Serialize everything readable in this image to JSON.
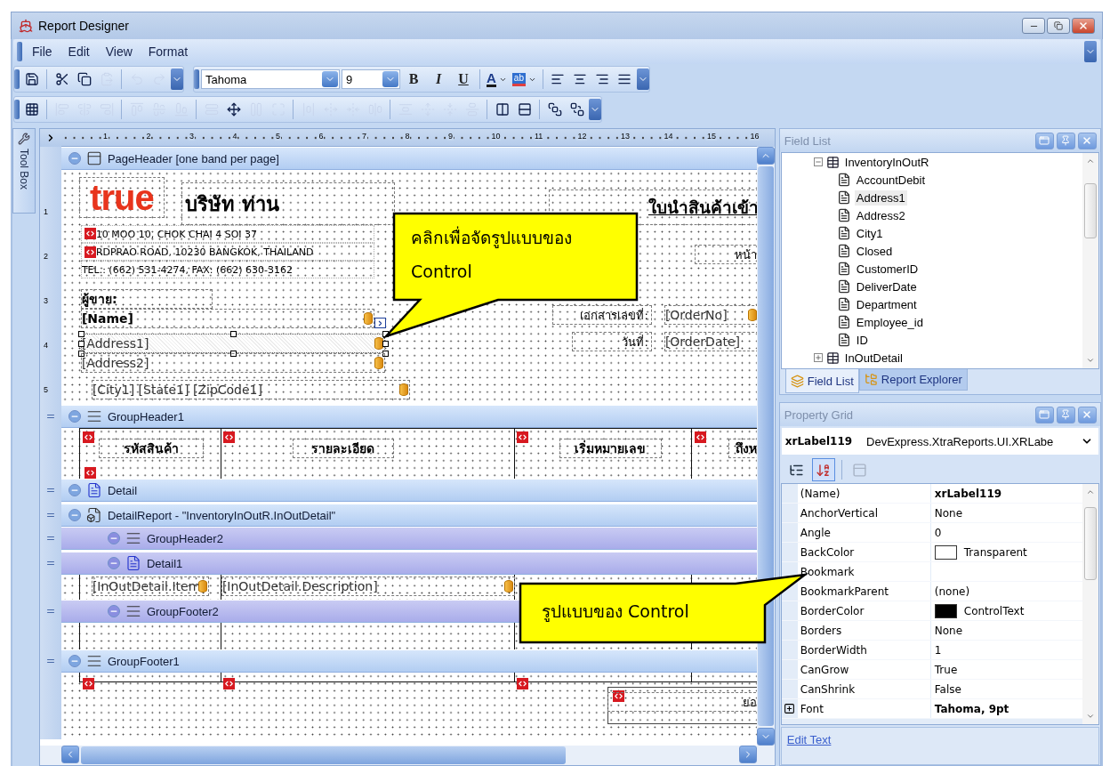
{
  "window": {
    "title": "Report Designer"
  },
  "menu": [
    {
      "label": "File"
    },
    {
      "label": "Edit"
    },
    {
      "label": "View"
    },
    {
      "label": "Format"
    }
  ],
  "toolbars": [
    {
      "groups": [
        [
          {
            "kind": "save",
            "disabled": false
          },
          {
            "kind": "sep"
          },
          {
            "kind": "cut",
            "disabled": false
          },
          {
            "kind": "copy",
            "disabled": false
          },
          {
            "kind": "paste",
            "disabled": true
          },
          {
            "kind": "sep"
          },
          {
            "kind": "undo",
            "disabled": true
          },
          {
            "kind": "redo",
            "disabled": true
          },
          {
            "kind": "overflow"
          }
        ],
        [
          {
            "kind": "combo",
            "value": "Tahoma"
          },
          {
            "kind": "size",
            "value": "9"
          },
          {
            "kind": "bold",
            "label": "B"
          },
          {
            "kind": "italic",
            "label": "I"
          },
          {
            "kind": "underline",
            "label": "U"
          },
          {
            "kind": "sep"
          },
          {
            "kind": "font_color",
            "label": "A"
          },
          {
            "kind": "highlight",
            "label": "ab"
          },
          {
            "kind": "sep"
          },
          {
            "kind": "align_left",
            "disabled": false
          },
          {
            "kind": "align_center",
            "disabled": false
          },
          {
            "kind": "align_right",
            "disabled": false
          },
          {
            "kind": "justify",
            "disabled": false
          },
          {
            "kind": "overflow"
          }
        ]
      ]
    },
    {
      "groups": [
        [
          {
            "kind": "snap_grid",
            "disabled": false
          },
          {
            "kind": "sep"
          },
          {
            "kind": "align_lefts",
            "disabled": true
          },
          {
            "kind": "align_centers",
            "disabled": true
          },
          {
            "kind": "align_rights",
            "disabled": true
          },
          {
            "kind": "sep"
          },
          {
            "kind": "align_tops",
            "disabled": true
          },
          {
            "kind": "align_middles",
            "disabled": true
          },
          {
            "kind": "align_bottoms",
            "disabled": true
          },
          {
            "kind": "sep"
          },
          {
            "kind": "same_width",
            "disabled": true
          },
          {
            "kind": "size_to_grid",
            "disabled": false
          },
          {
            "kind": "same_height",
            "disabled": true
          },
          {
            "kind": "same_size",
            "disabled": true
          },
          {
            "kind": "sep"
          },
          {
            "kind": "h_equal",
            "disabled": true
          },
          {
            "kind": "h_inc",
            "disabled": true
          },
          {
            "kind": "h_dec",
            "disabled": true
          },
          {
            "kind": "h_remove",
            "disabled": true
          },
          {
            "kind": "sep"
          },
          {
            "kind": "v_equal",
            "disabled": true
          },
          {
            "kind": "v_inc",
            "disabled": true
          },
          {
            "kind": "v_dec",
            "disabled": true
          },
          {
            "kind": "v_remove",
            "disabled": true
          },
          {
            "kind": "sep"
          },
          {
            "kind": "center_h",
            "disabled": false
          },
          {
            "kind": "center_v",
            "disabled": false
          },
          {
            "kind": "sep"
          },
          {
            "kind": "bring_front",
            "disabled": false
          },
          {
            "kind": "send_back",
            "disabled": false
          },
          {
            "kind": "overflow"
          }
        ]
      ]
    }
  ],
  "toolbox": {
    "label": "Tool Box"
  },
  "designer": {
    "ruler": [
      "1",
      "2",
      "3",
      "4",
      "5",
      "6",
      "7",
      "8",
      "9",
      "10",
      "11",
      "12",
      "13",
      "14",
      "15",
      "16"
    ],
    "bands": [
      {
        "kind": "page_header",
        "title": "PageHeader [one band per page]",
        "ruler": [
          "1",
          "2",
          "3",
          "4",
          "5"
        ],
        "controls": [
          {
            "kind": "logo",
            "text": "true",
            "selected": false,
            "bound": false
          },
          {
            "kind": "heading",
            "text": "บริษัท ท่าน",
            "selected": false,
            "bound": false
          },
          {
            "kind": "title",
            "text": "ใบนำสินค้าเข้า",
            "selected": false,
            "bound": false
          },
          {
            "kind": "small",
            "text": "10 MOO 10, CHOK CHAI 4 SOI 37",
            "selected": false,
            "bound": false
          },
          {
            "kind": "small",
            "text": "RDPRAO ROAD, 10230 BANGKOK, THAILAND",
            "selected": false,
            "bound": false
          },
          {
            "kind": "small",
            "text": "TEL.: (662) 531-4274, FAX: (662) 630-3162",
            "selected": false,
            "bound": false
          },
          {
            "kind": "right",
            "text": "หน้า",
            "selected": false,
            "bound": false
          },
          {
            "kind": "strong",
            "text": "ผู้ขาย:",
            "selected": false,
            "bound": false
          },
          {
            "kind": "strong",
            "text": "[Name]",
            "selected": false,
            "bound": true
          },
          {
            "kind": "field",
            "text": "[Address1]",
            "selected": true,
            "bound": true
          },
          {
            "kind": "field",
            "text": "[Address2]",
            "selected": false,
            "bound": true
          },
          {
            "kind": "field",
            "text": "[City1] [State1] [ZipCode1]",
            "selected": false,
            "bound": true
          },
          {
            "kind": "right",
            "text": "เอกสารเลขที่:",
            "selected": false,
            "bound": false
          },
          {
            "kind": "field",
            "text": "[OrderNo]",
            "selected": false,
            "bound": true
          },
          {
            "kind": "right",
            "text": "วันที่:",
            "selected": false,
            "bound": false
          },
          {
            "kind": "field",
            "text": "[OrderDate]",
            "selected": false,
            "bound": false
          }
        ]
      },
      {
        "kind": "group_header",
        "title": "GroupHeader1",
        "controls": [
          {
            "kind": "cell",
            "text": "รหัสสินค้า",
            "selected": false,
            "bound": false
          },
          {
            "kind": "cell",
            "text": "รายละเอียด",
            "selected": false,
            "bound": false
          },
          {
            "kind": "cell",
            "text": "เริ่มหมายเลข",
            "selected": false,
            "bound": false
          },
          {
            "kind": "cell",
            "text": "ถึงห",
            "selected": false,
            "bound": false
          }
        ]
      },
      {
        "kind": "detail",
        "title": "Detail"
      },
      {
        "kind": "detail_report",
        "title": "DetailReport - \"InventoryInOutR.InOutDetail\"",
        "children": [
          {
            "kind": "group_header",
            "title": "GroupHeader2"
          },
          {
            "kind": "detail",
            "title": "Detail1",
            "controls": [
              {
                "kind": "field",
                "text": "[InOutDetail.Item",
                "selected": false,
                "bound": true
              },
              {
                "kind": "field",
                "text": "[InOutDetail.Description]",
                "selected": false,
                "bound": true
              }
            ]
          },
          {
            "kind": "group_footer",
            "title": "GroupFooter2"
          }
        ]
      },
      {
        "kind": "group_footer",
        "title": "GroupFooter1",
        "controls": [
          {
            "kind": "right",
            "text": "ยอ",
            "selected": false,
            "bound": false
          }
        ]
      }
    ]
  },
  "field_list": {
    "title": "Field List",
    "tree": [
      {
        "label": "InventoryInOutR",
        "kind": "table",
        "expanded": true,
        "selected": false,
        "children": [
          {
            "label": "AccountDebit",
            "kind": "field",
            "selected": false
          },
          {
            "label": "Address1",
            "kind": "field",
            "selected": true
          },
          {
            "label": "Address2",
            "kind": "field",
            "selected": false
          },
          {
            "label": "City1",
            "kind": "field",
            "selected": false
          },
          {
            "label": "Closed",
            "kind": "field",
            "selected": false
          },
          {
            "label": "CustomerID",
            "kind": "field",
            "selected": false
          },
          {
            "label": "DeliverDate",
            "kind": "field",
            "selected": false
          },
          {
            "label": "Department",
            "kind": "field",
            "selected": false
          },
          {
            "label": "Employee_id",
            "kind": "field",
            "selected": false
          },
          {
            "label": "ID",
            "kind": "field",
            "selected": false
          }
        ]
      },
      {
        "label": "InOutDetail",
        "kind": "table",
        "expanded": false,
        "selected": false
      }
    ],
    "tabs": [
      {
        "label": "Field List",
        "selected": true
      },
      {
        "label": "Report Explorer",
        "selected": false
      }
    ]
  },
  "property_grid": {
    "title": "Property Grid",
    "object_name": "xrLabel119",
    "object_type": "DevExpress.XtraReports.UI.XRLabe",
    "tools": [
      {
        "kind": "categorized",
        "selected": false,
        "disabled": false
      },
      {
        "kind": "alphabetical",
        "selected": true,
        "disabled": false
      },
      {
        "kind": "property_pages",
        "selected": false,
        "disabled": true
      }
    ],
    "rows": [
      {
        "name": "(Name)",
        "value": "xrLabel119",
        "modified": true,
        "expandable": false
      },
      {
        "name": "AnchorVertical",
        "value": "None",
        "modified": false,
        "expandable": false
      },
      {
        "name": "Angle",
        "value": "0",
        "modified": false,
        "expandable": false
      },
      {
        "name": "BackColor",
        "value": "Transparent",
        "color": "#ffffff",
        "modified": false,
        "expandable": false
      },
      {
        "name": "Bookmark",
        "expandable": false
      },
      {
        "name": "BookmarkParent",
        "value": "(none)",
        "modified": false,
        "expandable": false
      },
      {
        "name": "BorderColor",
        "value": "ControlText",
        "color": "#000000",
        "modified": false,
        "expandable": false
      },
      {
        "name": "Borders",
        "value": "None",
        "modified": false,
        "expandable": false
      },
      {
        "name": "BorderWidth",
        "value": "1",
        "modified": false,
        "expandable": false
      },
      {
        "name": "CanGrow",
        "value": "True",
        "modified": false,
        "expandable": false
      },
      {
        "name": "CanShrink",
        "value": "False",
        "modified": false,
        "expandable": false
      },
      {
        "name": "Font",
        "value": "Tahoma, 9pt",
        "modified": true,
        "expandable": true
      }
    ],
    "link": "Edit Text"
  },
  "callouts": [
    {
      "lines": [
        "คลิกเพื่อจัดรูปแบบของ",
        "Control"
      ]
    },
    {
      "lines": [
        "รูปแบบของ Control"
      ]
    }
  ]
}
